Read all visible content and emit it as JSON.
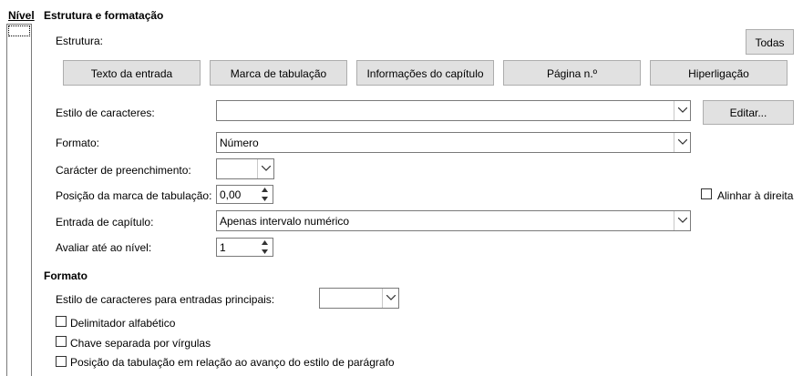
{
  "level": {
    "header": "Nível"
  },
  "structure_section": {
    "title": "Estrutura e formatação",
    "structure_label": "Estrutura:",
    "all_button": "Todas",
    "buttons": [
      "Texto da entrada",
      "Marca de tabulação",
      "Informações do capítulo",
      "Página n.º",
      "Hiperligação"
    ],
    "char_style_label": "Estilo de caracteres:",
    "char_style_value": "",
    "edit_button": "Editar...",
    "format_label": "Formato:",
    "format_value": "Número",
    "fill_char_label": "Carácter de preenchimento:",
    "fill_char_value": "",
    "tab_pos_label": "Posição da marca de tabulação:",
    "tab_pos_value": "0,00",
    "align_right_label": "Alinhar à direita",
    "chapter_entry_label": "Entrada de capítulo:",
    "chapter_entry_value": "Apenas intervalo numérico",
    "eval_level_label": "Avaliar até ao nível:",
    "eval_level_value": "1"
  },
  "format_section": {
    "title": "Formato",
    "main_entries_style_label": "Estilo de caracteres para entradas principais:",
    "main_entries_style_value": "",
    "checkboxes": [
      "Delimitador alfabético",
      "Chave separada por vírgulas",
      "Posição da tabulação em relação ao avanço do estilo de parágrafo"
    ]
  }
}
